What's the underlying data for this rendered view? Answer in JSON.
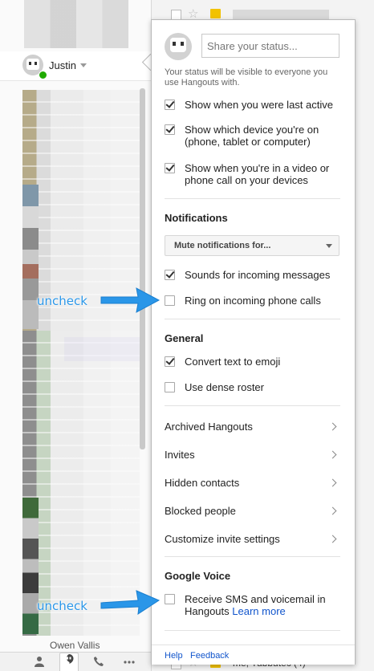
{
  "me": {
    "name": "Justin"
  },
  "status": {
    "placeholder": "Share your status...",
    "note": "Your status will be visible to everyone you use Hangouts with."
  },
  "privacy": [
    {
      "label": "Show when you were last active",
      "checked": true
    },
    {
      "label": "Show which device you're on (phone, tablet or computer)",
      "checked": true
    },
    {
      "label": "Show when you're in a video or phone call on your devices",
      "checked": true
    }
  ],
  "notifications": {
    "title": "Notifications",
    "mute_label": "Mute notifications for...",
    "items": [
      {
        "label": "Sounds for incoming messages",
        "checked": true
      },
      {
        "label": "Ring on incoming phone calls",
        "checked": false
      }
    ]
  },
  "general": {
    "title": "General",
    "items": [
      {
        "label": "Convert text to emoji",
        "checked": true
      },
      {
        "label": "Use dense roster",
        "checked": false
      }
    ]
  },
  "nav": [
    {
      "label": "Archived Hangouts"
    },
    {
      "label": "Invites"
    },
    {
      "label": "Hidden contacts"
    },
    {
      "label": "Blocked people"
    },
    {
      "label": "Customize invite settings"
    }
  ],
  "google_voice": {
    "title": "Google Voice",
    "item_label": "Receive SMS and voicemail in Hangouts",
    "learn_more": "Learn more",
    "checked": false
  },
  "footer": {
    "help": "Help",
    "feedback": "Feedback"
  },
  "annotations": {
    "uncheck_1": "uncheck",
    "uncheck_2": "uncheck"
  },
  "background": {
    "roster_bottom_name": "Owen Vallis",
    "mail_bottom_text": "me, Tubbutec (4)"
  },
  "colors": {
    "annotation": "#2a96e8",
    "link": "#1155cc",
    "online": "#1faa00"
  },
  "icons": [
    "person-icon",
    "hangouts-icon",
    "phone-icon",
    "more-icon",
    "chevron-right-icon",
    "checkbox-icon",
    "star-icon",
    "label-icon"
  ]
}
